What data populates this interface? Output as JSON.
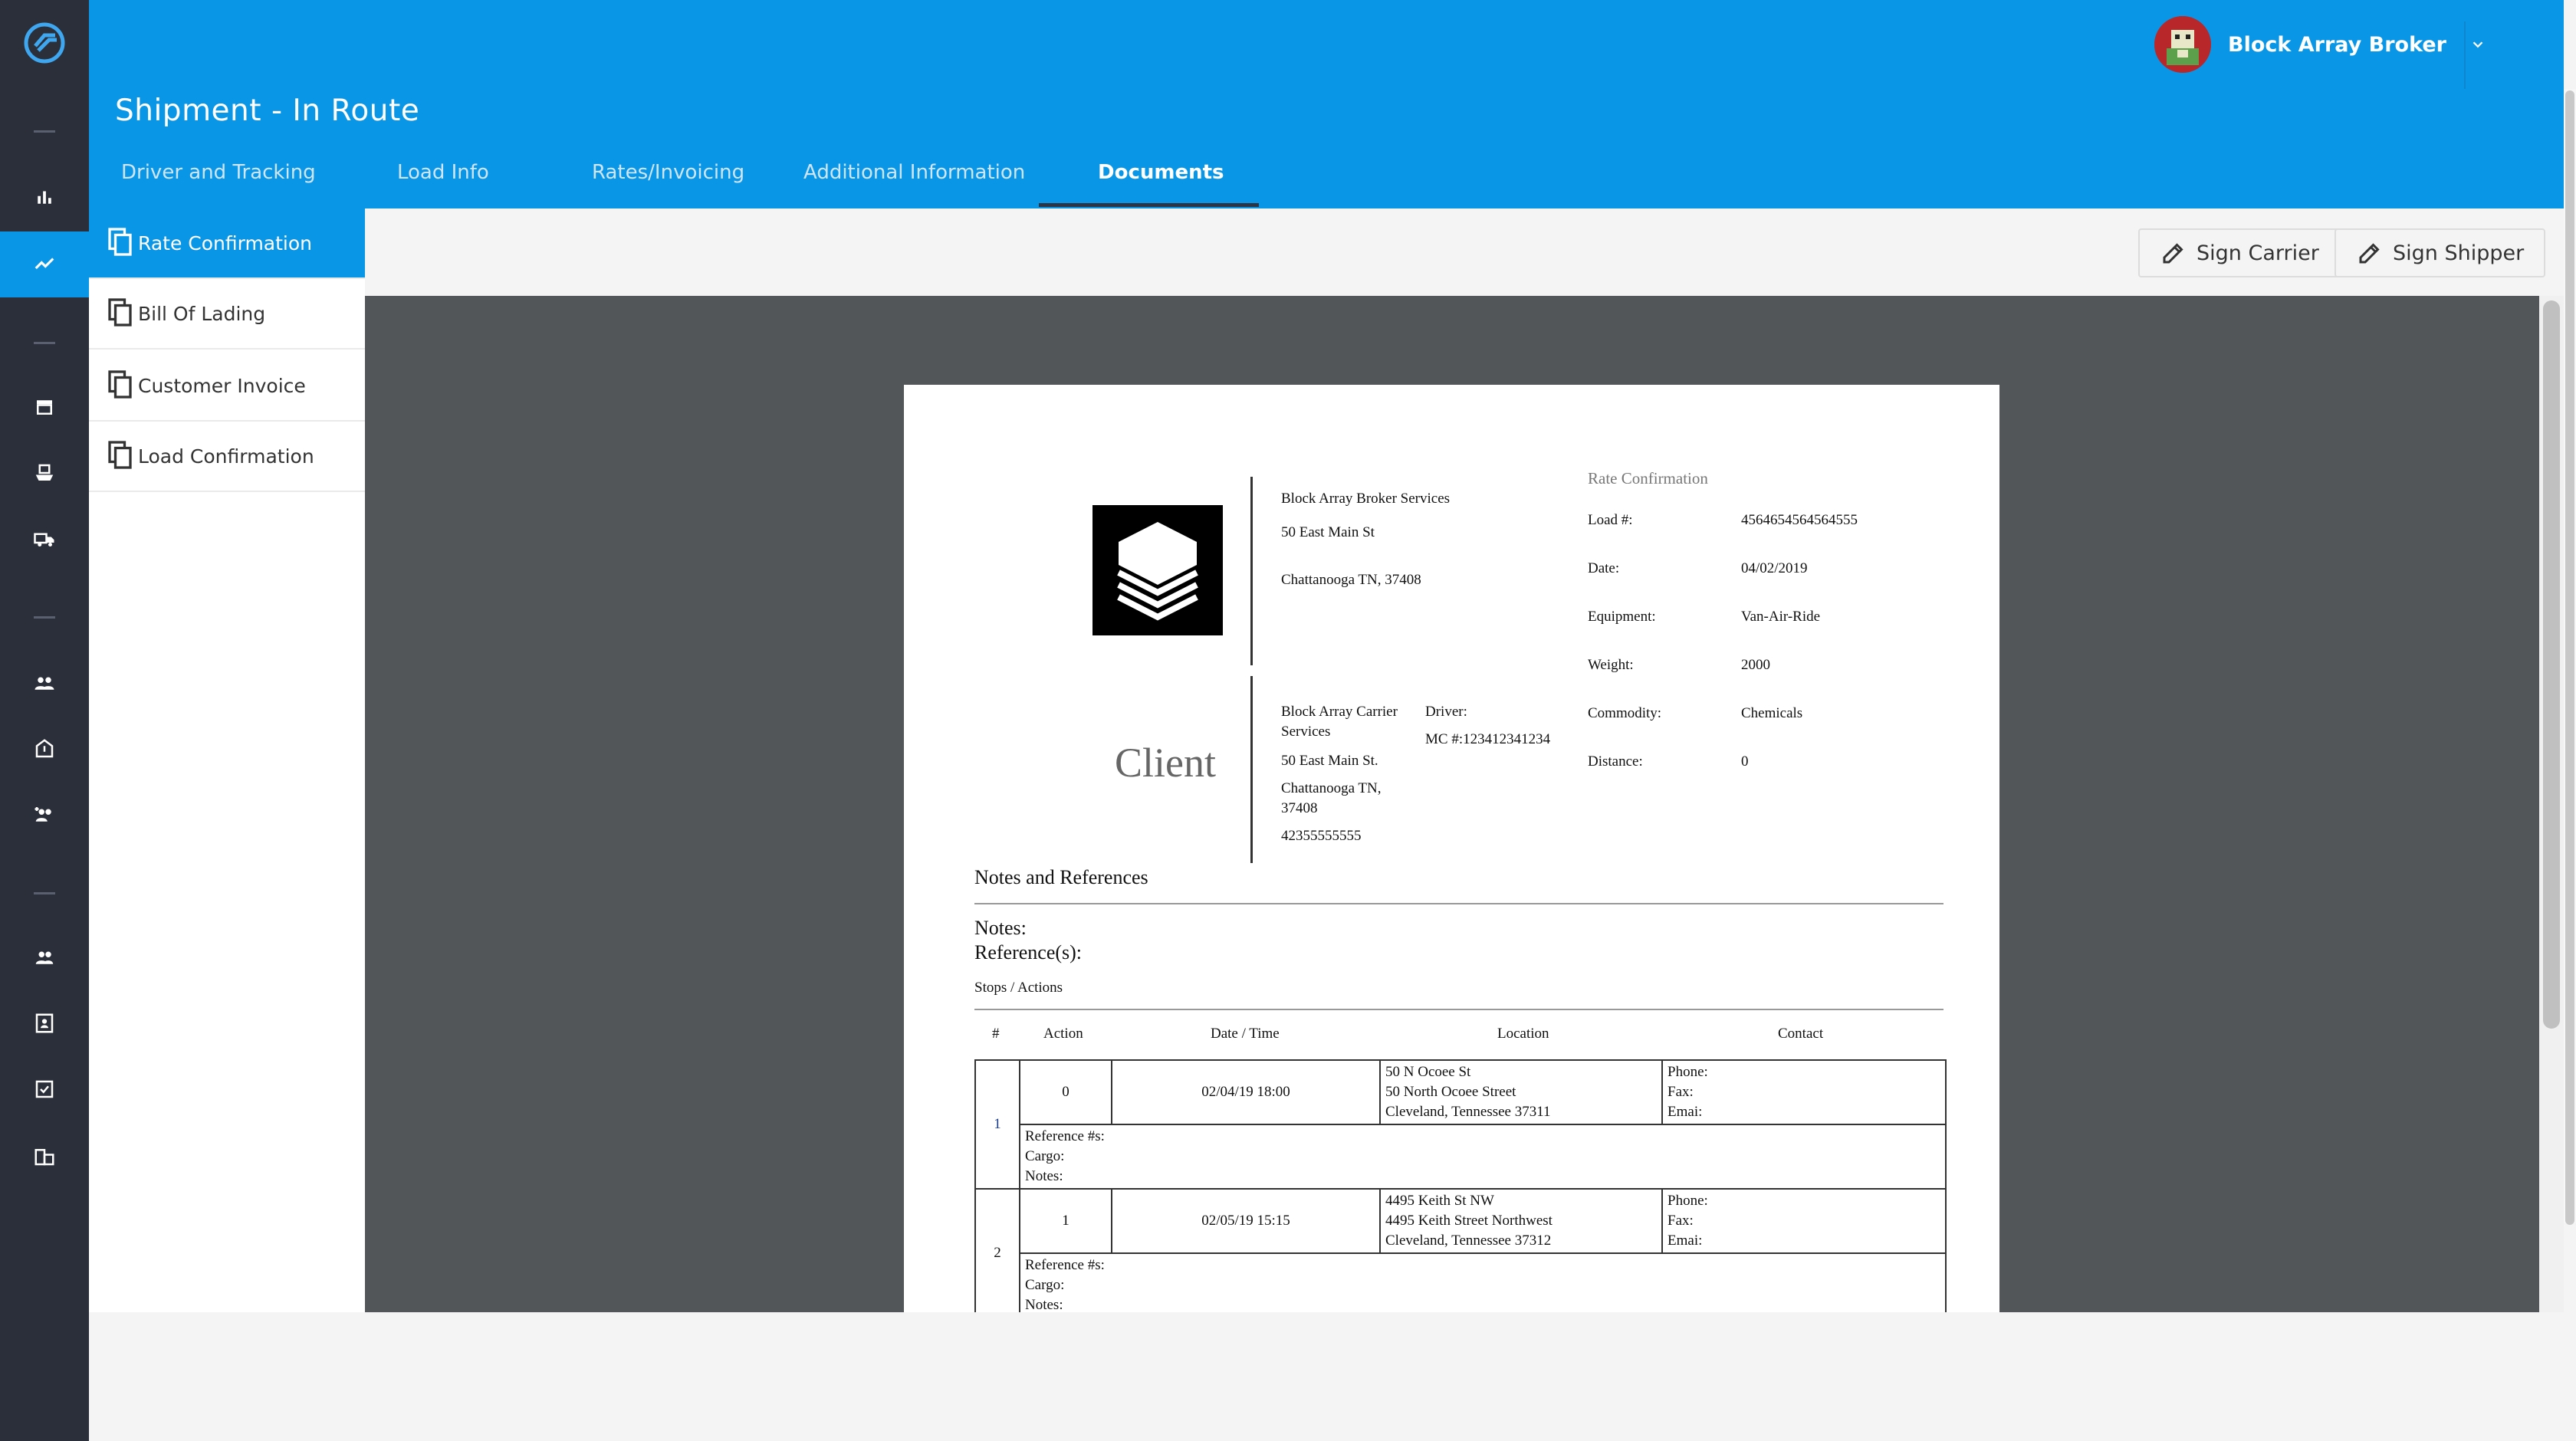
{
  "header": {
    "title": "Shipment - In Route",
    "tabs": [
      {
        "label": "Driver and Tracking"
      },
      {
        "label": "Load Info"
      },
      {
        "label": "Rates/Invoicing"
      },
      {
        "label": "Additional Information"
      },
      {
        "label": "Documents"
      }
    ],
    "active_tab": "Documents",
    "user_name": "Block Array Broker"
  },
  "documents": [
    {
      "label": "Rate Confirmation",
      "active": true
    },
    {
      "label": "Bill Of Lading",
      "active": false
    },
    {
      "label": "Customer Invoice",
      "active": false
    },
    {
      "label": "Load Confirmation",
      "active": false
    }
  ],
  "toolbar": {
    "sign_carrier": "Sign Carrier",
    "sign_shipper": "Sign Shipper"
  },
  "rail": {
    "icons": [
      "logo-icon",
      "bar-chart-icon",
      "trending-icon",
      "store-icon",
      "ship-icon",
      "truck-icon",
      "group-icon",
      "building-alert-icon",
      "group-add-icon",
      "people-icon",
      "contact-card-icon",
      "check-box-icon",
      "business-icon"
    ],
    "active": "trending-icon"
  },
  "colors": {
    "brand": "#0a96e6",
    "rail": "#2a2f3a",
    "viewer": "#525659"
  },
  "doc": {
    "broker": {
      "name": "Block Array Broker Services",
      "street": "50 East Main St",
      "city": "Chattanooga TN, 37408"
    },
    "carrier": {
      "name_line1": "Block Array Carrier",
      "name_line2": "Services",
      "street": "50 East Main St.",
      "city_line1": "Chattanooga TN,",
      "city_line2": "37408",
      "phone": "42355555555",
      "driver_label": "Driver:",
      "mc": "MC #:123412341234"
    },
    "client_label": "Client",
    "rc_title": "Rate Confirmation",
    "fields": [
      {
        "label": "Load #:",
        "value": "4564654564564555"
      },
      {
        "label": "Date:",
        "value": "04/02/2019"
      },
      {
        "label": "Equipment:",
        "value": "Van-Air-Ride"
      },
      {
        "label": "Weight:",
        "value": "2000"
      },
      {
        "label": "Commodity:",
        "value": "Chemicals"
      },
      {
        "label": "Distance:",
        "value": "0"
      }
    ],
    "notes_heading": "Notes and References",
    "notes_label": "Notes:",
    "references_label": "Reference(s):",
    "stops_heading": "Stops / Actions",
    "stops_columns": [
      "#",
      "Action",
      "Date / Time",
      "Location",
      "Contact"
    ],
    "stops": [
      {
        "num": "1",
        "action": "0",
        "datetime": "02/04/19 18:00",
        "loc1": "50 N Ocoee St",
        "loc2": "50 North Ocoee Street",
        "loc3": "Cleveland, Tennessee 37311",
        "phone": "Phone:",
        "fax": "Fax:",
        "email": "Emai:",
        "ref": "Reference #s:",
        "cargo": "Cargo:",
        "notes": "Notes:"
      },
      {
        "num": "2",
        "action": "1",
        "datetime": "02/05/19 15:15",
        "loc1": "4495 Keith St NW",
        "loc2": "4495 Keith Street Northwest",
        "loc3": "Cleveland, Tennessee 37312",
        "phone": "Phone:",
        "fax": "Fax:",
        "email": "Emai:",
        "ref": "Reference #s:",
        "cargo": "Cargo:",
        "notes": "Notes:"
      }
    ]
  }
}
